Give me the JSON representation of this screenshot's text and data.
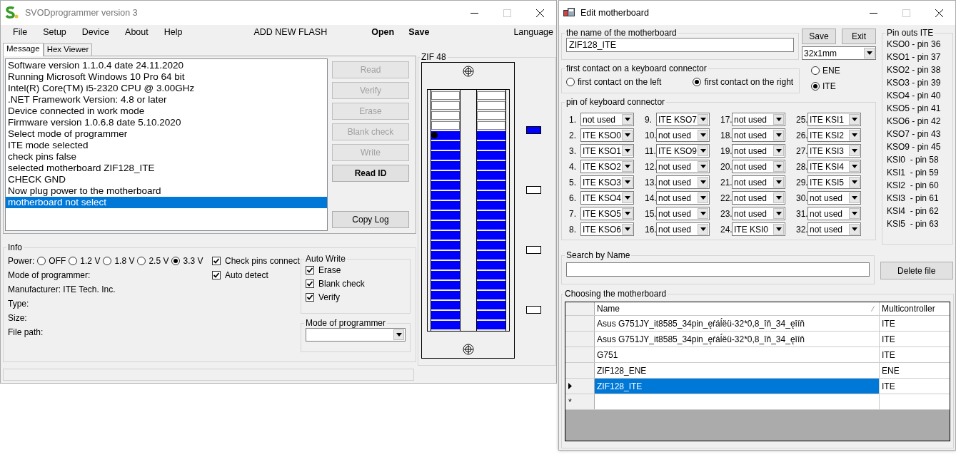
{
  "main_window": {
    "title": "SVODprogrammer version 3",
    "menu": [
      "File",
      "Setup",
      "Device",
      "About",
      "Help"
    ],
    "add_flash": "ADD NEW FLASH",
    "file_actions": [
      "Open",
      "Save"
    ],
    "language": "Language",
    "tabs": [
      {
        "label": "Message",
        "selected": true
      },
      {
        "label": "Hex Viewer",
        "selected": false
      }
    ],
    "log": [
      {
        "text": "Software version 1.1.0.4 date 24.11.2020",
        "selected": false
      },
      {
        "text": "Running Microsoft Windows 10 Pro 64 bit",
        "selected": false
      },
      {
        "text": "Intel(R) Core(TM) i5-2320 CPU @ 3.00GHz",
        "selected": false
      },
      {
        "text": ".NET Framework Version: 4.8 or later",
        "selected": false
      },
      {
        "text": "Device connected in work mode",
        "selected": false
      },
      {
        "text": "Firmware version 1.0.6.8 date 5.10.2020",
        "selected": false
      },
      {
        "text": "Select mode of programmer",
        "selected": false
      },
      {
        "text": "ITE mode selected",
        "selected": false
      },
      {
        "text": "check pins false",
        "selected": false
      },
      {
        "text": "selected motherboard ZIF128_ITE",
        "selected": false
      },
      {
        "text": "CHECK GND",
        "selected": false
      },
      {
        "text": "Now plug power to the motherboard",
        "selected": false
      },
      {
        "text": "motherboard not select",
        "selected": true
      }
    ],
    "buttons": [
      {
        "label": "Read",
        "disabled": true,
        "kind": "command"
      },
      {
        "label": "Verify",
        "disabled": true,
        "kind": "command"
      },
      {
        "label": "Erase",
        "disabled": true,
        "kind": "command"
      },
      {
        "label": "Blank check",
        "disabled": true,
        "kind": "command"
      },
      {
        "label": "Write",
        "disabled": true,
        "kind": "command"
      },
      {
        "label": "Read ID",
        "disabled": false,
        "kind": "primary"
      }
    ],
    "copy_log": "Copy Log",
    "zif": {
      "title": "ZIF 48",
      "slots": [
        {
          "on": false
        },
        {
          "on": false
        },
        {
          "on": false
        },
        {
          "on": false
        },
        {
          "on": true
        },
        {
          "on": true
        },
        {
          "on": true
        },
        {
          "on": true
        },
        {
          "on": true
        },
        {
          "on": true
        },
        {
          "on": true
        },
        {
          "on": true
        },
        {
          "on": true
        },
        {
          "on": true
        },
        {
          "on": true
        },
        {
          "on": true
        },
        {
          "on": true
        },
        {
          "on": true
        },
        {
          "on": true
        },
        {
          "on": true
        },
        {
          "on": true
        },
        {
          "on": true
        },
        {
          "on": true
        },
        {
          "on": true
        }
      ],
      "indicators": [
        {
          "on": true
        },
        {
          "on": false
        },
        {
          "on": false
        },
        {
          "on": false
        }
      ]
    },
    "info": {
      "title": "Info",
      "power_label": "Power:",
      "power": [
        {
          "label": "OFF",
          "selected": false
        },
        {
          "label": "1.2 V",
          "selected": false
        },
        {
          "label": "1.8 V",
          "selected": false
        },
        {
          "label": "2.5 V",
          "selected": false
        },
        {
          "label": "3.3 V",
          "selected": true
        }
      ],
      "checks": [
        {
          "label": "Check pins connect",
          "checked": true
        },
        {
          "label": "Auto detect",
          "checked": true
        }
      ],
      "fields": [
        "Mode of programmer:",
        "Manufacturer: ITE Tech. Inc.",
        "Type:",
        "Size:",
        "File path:"
      ],
      "auto_write": {
        "title": "Auto Write",
        "options": [
          {
            "label": "Erase",
            "checked": true
          },
          {
            "label": "Blank check",
            "checked": true
          },
          {
            "label": "Verify",
            "checked": true
          }
        ]
      },
      "mode_group": {
        "title": "Mode of programmer"
      }
    }
  },
  "editor": {
    "title": "Edit motherboard",
    "name_group": {
      "title": "the name of the motherboard",
      "value": "ZIF128_ITE"
    },
    "buttons": [
      "Save",
      "Exit"
    ],
    "size_select": "32x1mm",
    "first_contact": {
      "title": "first contact on a keyboard connector",
      "options": [
        {
          "label": "first contact on the left",
          "selected": false
        },
        {
          "label": "first contact on the right",
          "selected": true
        }
      ]
    },
    "controller": [
      {
        "label": "ENE",
        "selected": false
      },
      {
        "label": "ITE",
        "selected": true
      }
    ],
    "pins": {
      "title": "pin of keyboard connector",
      "items": [
        {
          "number": "1.",
          "value": "not used"
        },
        {
          "number": "2.",
          "value": "ITE KSO0"
        },
        {
          "number": "3.",
          "value": "ITE KSO1"
        },
        {
          "number": "4.",
          "value": "ITE KSO2"
        },
        {
          "number": "5.",
          "value": "ITE KSO3"
        },
        {
          "number": "6.",
          "value": "ITE KSO4"
        },
        {
          "number": "7.",
          "value": "ITE KSO5"
        },
        {
          "number": "8.",
          "value": "ITE KSO6"
        },
        {
          "number": "9.",
          "value": "ITE KSO7"
        },
        {
          "number": "10.",
          "value": "not used"
        },
        {
          "number": "11.",
          "value": "ITE KSO9"
        },
        {
          "number": "12.",
          "value": "not used"
        },
        {
          "number": "13.",
          "value": "not used"
        },
        {
          "number": "14.",
          "value": "not used"
        },
        {
          "number": "15.",
          "value": "not used"
        },
        {
          "number": "16.",
          "value": "not used"
        },
        {
          "number": "17.",
          "value": "not used"
        },
        {
          "number": "18.",
          "value": "not used"
        },
        {
          "number": "19.",
          "value": "not used"
        },
        {
          "number": "20.",
          "value": "not used"
        },
        {
          "number": "21.",
          "value": "not used"
        },
        {
          "number": "22.",
          "value": "not used"
        },
        {
          "number": "23.",
          "value": "not used"
        },
        {
          "number": "24.",
          "value": "ITE KSI0"
        },
        {
          "number": "25.",
          "value": "ITE KSI1"
        },
        {
          "number": "26.",
          "value": "ITE KSI2"
        },
        {
          "number": "27.",
          "value": "ITE KSI3"
        },
        {
          "number": "28.",
          "value": "ITE KSI4"
        },
        {
          "number": "29.",
          "value": "ITE KSI5"
        },
        {
          "number": "30.",
          "value": "not used"
        },
        {
          "number": "31.",
          "value": "not used"
        },
        {
          "number": "32.",
          "value": "not used"
        }
      ]
    },
    "pinouts": {
      "title": "Pin outs ITE",
      "lines": [
        "KSO0 - pin 36",
        "KSO1 - pin 37",
        "KSO2 - pin 38",
        "KSO3 - pin 39",
        "KSO4 - pin 40",
        "KSO5 - pin 41",
        "KSO6 - pin 42",
        "KSO7 - pin 43",
        "KSO9 - pin 45",
        "KSI0  - pin 58",
        "KSI1  - pin 59",
        "KSI2  - pin 60",
        "KSI3  - pin 61",
        "KSI4  - pin 62",
        "KSI5  - pin 63"
      ]
    },
    "search": {
      "title": "Search by Name"
    },
    "delete_button": "Delete file",
    "grid": {
      "title": "Choosing the motherboard",
      "columns": [
        "Name",
        "Multicontroller"
      ],
      "rows": [
        {
          "kind": "data",
          "name": "Asus G751JY_it8585_34pin_ęŕáĺëü-32*0,8_îň_34_ęîíň",
          "controller": "ITE",
          "selected": false
        },
        {
          "kind": "data",
          "name": "Asus G751JY_it8585_34pin_ęŕáĺëü-32*0,8_îň_34_ęîíň",
          "controller": "ITE",
          "selected": false
        },
        {
          "kind": "data",
          "name": "G751",
          "controller": "ITE",
          "selected": false
        },
        {
          "kind": "data",
          "name": "ZIF128_ENE",
          "controller": "ENE",
          "selected": false
        },
        {
          "kind": "data",
          "name": "ZIF128_ITE",
          "controller": "ITE",
          "selected": true
        },
        {
          "kind": "new",
          "marker": "*"
        }
      ]
    }
  }
}
